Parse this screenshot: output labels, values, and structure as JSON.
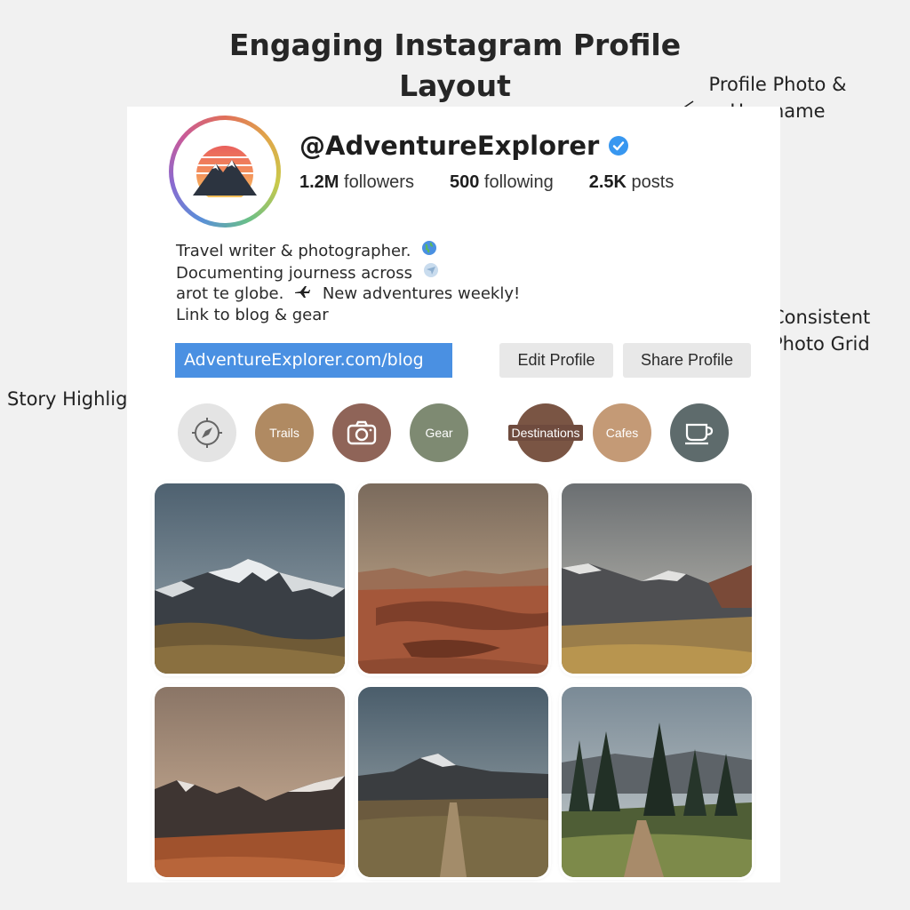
{
  "page": {
    "title_line1": "Engaging Instagram Profile",
    "title_line2": "Layout"
  },
  "annotations": {
    "profile_line1": "Profile Photo &",
    "profile_line2": "Username",
    "grid_line1": "Consistent",
    "grid_line2": "Photo Grid",
    "stories": "Story Highlights"
  },
  "profile": {
    "username": "@AdventureExplorer",
    "verified_icon": "verified-badge-icon",
    "followers_count": "1.2M",
    "followers_label": "followers",
    "following_count": "500",
    "following_label": "following",
    "posts_count": "2.5K",
    "posts_label": "posts",
    "avatar_icon": "mountain-sunset-logo"
  },
  "bio": {
    "line1": "Travel writer & photographer.",
    "line2": "Documenting journess across",
    "line3a": "arot te globe.",
    "line3b": "New adventures weekly!",
    "line4": "Link to blog & gear",
    "globe_icon": "globe-icon",
    "map_icon": "map-icon",
    "plane_icon": "airplane-icon"
  },
  "actions": {
    "link_label": "AdventureExplorer.com/blog",
    "edit_label": "Edit Profile",
    "share_label": "Share Profile"
  },
  "highlights": [
    {
      "label": "",
      "icon": "compass-icon",
      "color": "#e4e4e4"
    },
    {
      "label": "Trails",
      "color": "#b08a62"
    },
    {
      "label": "",
      "icon": "camera-icon",
      "color": "#8f6458"
    },
    {
      "label": "Gear",
      "color": "#7e8a72"
    },
    {
      "label": "Destinations",
      "color": "#7a5544"
    },
    {
      "label": "Cafes",
      "color": "#c49a76"
    },
    {
      "label": "",
      "icon": "coffee-cup-icon",
      "color": "#5e6b6c"
    }
  ],
  "colors": {
    "accent_blue": "#4a90e2",
    "button_gray": "#e8e8e8",
    "background": "#f1f1f1"
  }
}
